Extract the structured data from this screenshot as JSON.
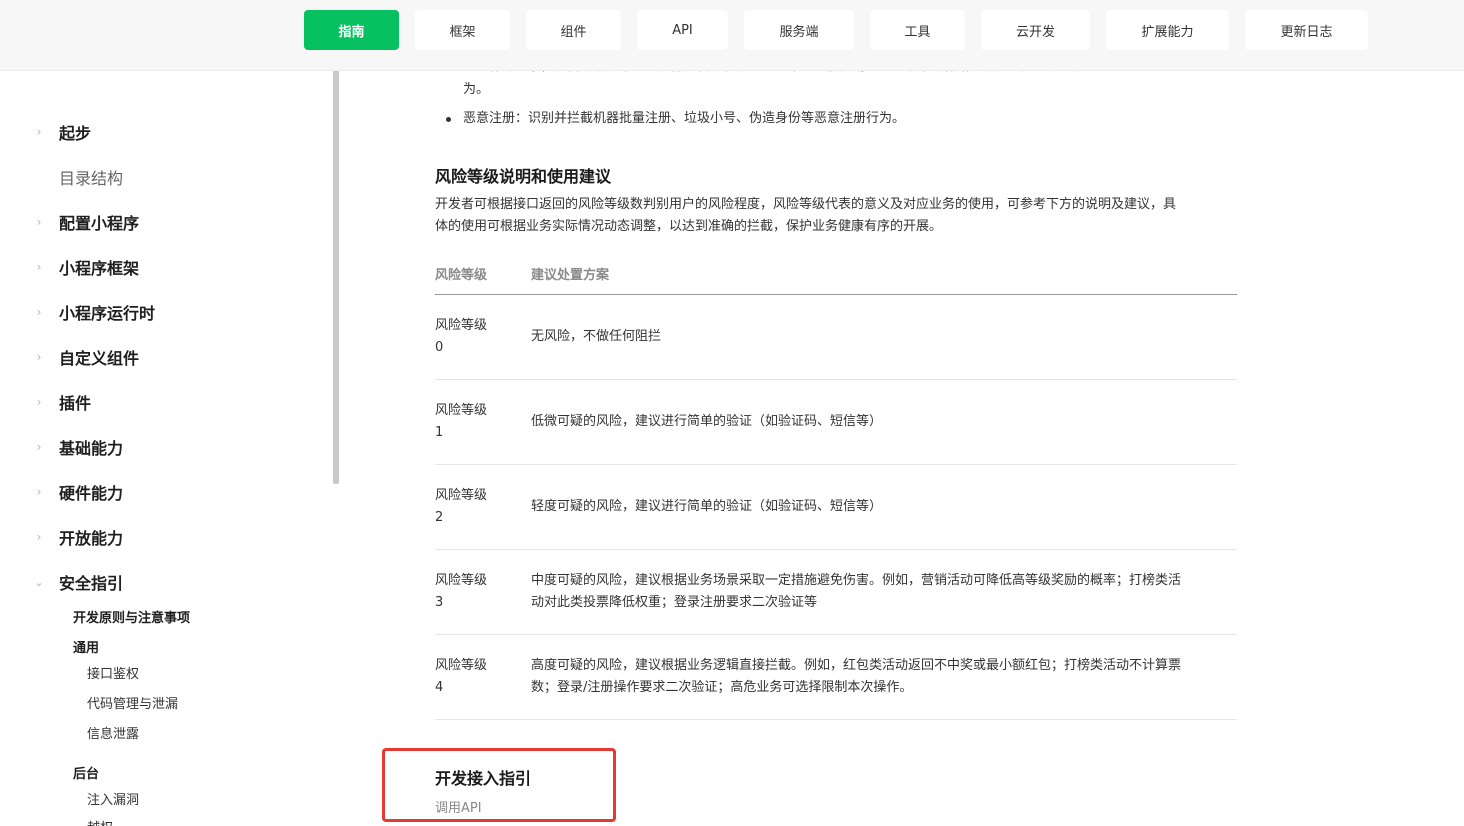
{
  "nav": {
    "tabs": [
      "指南",
      "框架",
      "组件",
      "API",
      "服务端",
      "工具",
      "云开发",
      "扩展能力",
      "更新日志"
    ],
    "active_index": 0,
    "accent_color": "#07c160"
  },
  "sidebar": {
    "items": [
      {
        "label": "起步",
        "chevron": "chevron-right-icon"
      },
      {
        "label": "目录结构",
        "chevron": null
      },
      {
        "label": "配置小程序",
        "chevron": "chevron-right-icon"
      },
      {
        "label": "小程序框架",
        "chevron": "chevron-right-icon"
      },
      {
        "label": "小程序运行时",
        "chevron": "chevron-right-icon"
      },
      {
        "label": "自定义组件",
        "chevron": "chevron-right-icon"
      },
      {
        "label": "插件",
        "chevron": "chevron-right-icon"
      },
      {
        "label": "基础能力",
        "chevron": "chevron-right-icon"
      },
      {
        "label": "硬件能力",
        "chevron": "chevron-right-icon"
      },
      {
        "label": "开放能力",
        "chevron": "chevron-right-icon"
      },
      {
        "label": "安全指引",
        "chevron": "chevron-down-icon"
      }
    ],
    "security_children": {
      "principles": "开发原则与注意事项",
      "general": "通用",
      "general_items": [
        "接口鉴权",
        "代码管理与泄漏",
        "信息泄露"
      ],
      "backend": "后台",
      "backend_items": [
        "注入漏洞",
        "越权..."
      ]
    }
  },
  "content": {
    "cutoff_line1": "已防作弊场景，在营销活动中识别机器等自动化行为或刷单、虚假交易、恶意领取操作给予较高风险判定的行",
    "cutoff_line2": "为。",
    "bullet_text": "恶意注册：识别并拦截机器批量注册、垃圾小号、伪造身份等恶意注册行为。",
    "risk_heading": "风险等级说明和使用建议",
    "risk_intro_1": "开发者可根据接口返回的风险等级数判别用户的风险程度，风险等级代表的意义及对应业务的使用，可参考下方的说明及建议，具",
    "risk_intro_2": "体的使用可根据业务实际情况动态调整，以达到准确的拦截，保护业务健康有序的开展。",
    "table": {
      "headers": [
        "风险等级",
        "建议处置方案"
      ],
      "rows": [
        {
          "level_a": "风险等级",
          "level_b": "0",
          "advice_1": "无风险，不做任何阻拦",
          "advice_2": ""
        },
        {
          "level_a": "风险等级",
          "level_b": "1",
          "advice_1": "低微可疑的风险，建议进行简单的验证（如验证码、短信等）",
          "advice_2": ""
        },
        {
          "level_a": "风险等级",
          "level_b": "2",
          "advice_1": "轻度可疑的风险，建议进行简单的验证（如验证码、短信等）",
          "advice_2": ""
        },
        {
          "level_a": "风险等级",
          "level_b": "3",
          "advice_1": "中度可疑的风险，建议根据业务场景采取一定措施避免伤害。例如，营销活动可降低高等级奖励的概率；打榜类活",
          "advice_2": "动对此类投票降低权重；登录注册要求二次验证等"
        },
        {
          "level_a": "风险等级",
          "level_b": "4",
          "advice_1": "高度可疑的风险，建议根据业务逻辑直接拦截。例如，红包类活动返回不中奖或最小额红包；打榜类活动不计算票",
          "advice_2": "数；登录/注册操作要求二次验证；高危业务可选择限制本次操作。"
        }
      ]
    },
    "dev_heading": "开发接入指引",
    "dev_sub": "调用API",
    "highlight_color": "#e53935"
  }
}
